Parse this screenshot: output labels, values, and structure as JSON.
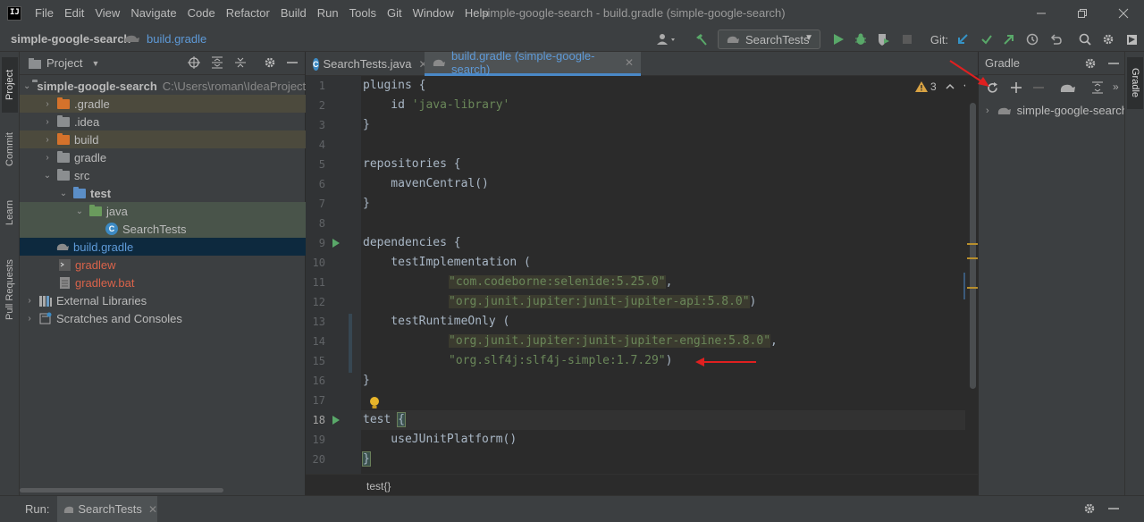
{
  "app": {
    "logo_text": "IJ",
    "window_title": "simple-google-search - build.gradle (simple-google-search)"
  },
  "menu": [
    "File",
    "Edit",
    "View",
    "Navigate",
    "Code",
    "Refactor",
    "Build",
    "Run",
    "Tools",
    "Git",
    "Window",
    "Help"
  ],
  "navbar": {
    "project": "simple-google-search",
    "file": "build.gradle",
    "run_config": "SearchTests",
    "git_label": "Git:"
  },
  "left_stripe": {
    "project": "Project",
    "commit": "Commit",
    "learn": "Learn",
    "pull_requests": "Pull Requests"
  },
  "project_panel": {
    "title": "Project",
    "root_name": "simple-google-search",
    "root_path": "C:\\Users\\roman\\IdeaProjects",
    "items": [
      {
        "label": ".gradle"
      },
      {
        "label": ".idea"
      },
      {
        "label": "build"
      },
      {
        "label": "gradle"
      },
      {
        "label": "src"
      },
      {
        "label": "test"
      },
      {
        "label": "java"
      },
      {
        "label": "SearchTests"
      },
      {
        "label": "build.gradle"
      },
      {
        "label": "gradlew"
      },
      {
        "label": "gradlew.bat"
      },
      {
        "label": "External Libraries"
      },
      {
        "label": "Scratches and Consoles"
      }
    ]
  },
  "editor_tabs": [
    {
      "label": "SearchTests.java"
    },
    {
      "label": "build.gradle (simple-google-search)"
    }
  ],
  "editor": {
    "warning_count": "3",
    "line_numbers": [
      "1",
      "2",
      "3",
      "4",
      "5",
      "6",
      "7",
      "8",
      "9",
      "10",
      "11",
      "12",
      "13",
      "14",
      "15",
      "16",
      "17",
      "18",
      "19",
      "20"
    ],
    "code": {
      "l1": "plugins {",
      "l2_a": "    id ",
      "l2_b": "'java-library'",
      "l3": "}",
      "l5": "repositories {",
      "l6": "    mavenCentral()",
      "l7": "}",
      "l9": "dependencies {",
      "l10": "    testImplementation (",
      "l11_s": "\"com.codeborne:selenide:5.25.0\"",
      "l12_s": "\"org.junit.jupiter:junit-jupiter-api:5.8.0\"",
      "l13": "    testRuntimeOnly (",
      "l14_s": "\"org.junit.jupiter:junit-jupiter-engine:5.8.0\"",
      "l15_s": "\"org.slf4j:slf4j-simple:1.7.29\"",
      "l16": "}",
      "l18_a": "test ",
      "l18_b": "{",
      "l19": "    useJUnitPlatform()",
      "l20": "}",
      "comma": ",",
      "paren": ")"
    },
    "breadcrumb": "test{}"
  },
  "gradle_panel": {
    "title": "Gradle",
    "root": "simple-google-search",
    "stripe_label": "Gradle"
  },
  "runbar": {
    "label": "Run:",
    "tab": "SearchTests"
  },
  "colors": {
    "accent": "#4a88c7",
    "run_green": "#59a869",
    "annotation_red": "#e02020"
  }
}
